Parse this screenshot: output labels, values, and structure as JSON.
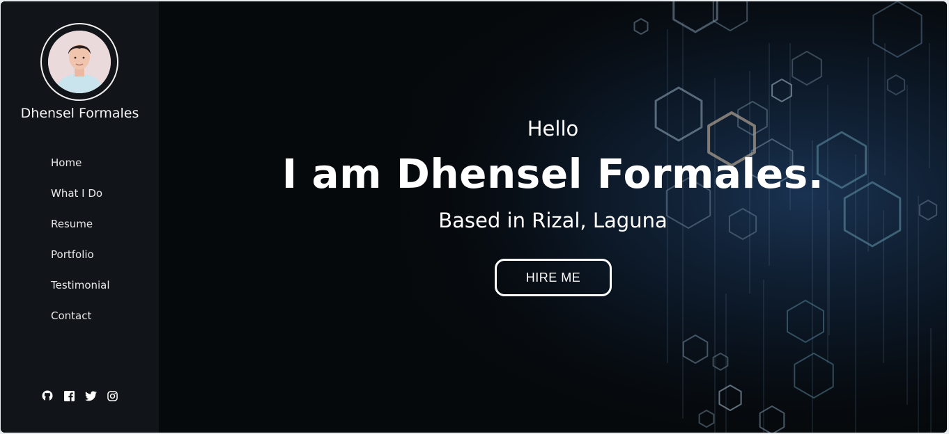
{
  "profile": {
    "name": "Dhensel Formales"
  },
  "nav": {
    "items": [
      {
        "label": "Home"
      },
      {
        "label": "What I Do"
      },
      {
        "label": "Resume"
      },
      {
        "label": "Portfolio"
      },
      {
        "label": "Testimonial"
      },
      {
        "label": "Contact"
      }
    ]
  },
  "socials": [
    "github-icon",
    "facebook-icon",
    "twitter-icon",
    "instagram-icon"
  ],
  "hero": {
    "greeting": "Hello",
    "headline": "I am Dhensel Formales.",
    "location": "Based in Rizal, Laguna",
    "cta_label": "HIRE ME"
  },
  "colors": {
    "sidebar_bg": "#111418",
    "main_bg": "#06090c",
    "accent_glow": "#1f3a5c",
    "text": "#ffffff"
  }
}
